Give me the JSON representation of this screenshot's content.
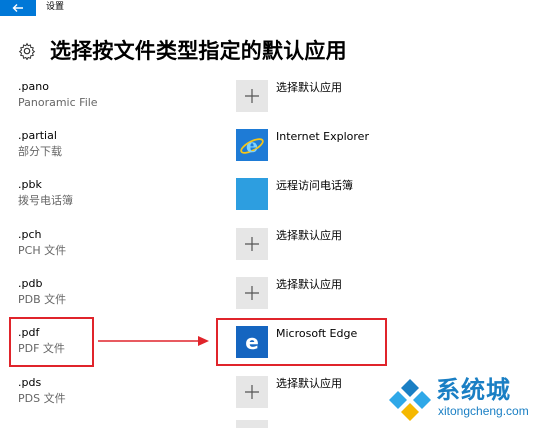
{
  "window": {
    "title": "设置"
  },
  "header": {
    "title": "选择按文件类型指定的默认应用"
  },
  "rows": [
    {
      "ext": ".pano",
      "desc": "Panoramic File",
      "app": "选择默认应用",
      "icon": "plus-icon"
    },
    {
      "ext": ".partial",
      "desc": "部分下载",
      "app": "Internet Explorer",
      "icon": "internet-explorer-icon"
    },
    {
      "ext": ".pbk",
      "desc": "拨号电话簿",
      "app": "远程访问电话簿",
      "icon": "blank-app-icon"
    },
    {
      "ext": ".pch",
      "desc": "PCH 文件",
      "app": "选择默认应用",
      "icon": "plus-icon"
    },
    {
      "ext": ".pdb",
      "desc": "PDB 文件",
      "app": "选择默认应用",
      "icon": "plus-icon"
    },
    {
      "ext": ".pdf",
      "desc": "PDF 文件",
      "app": "Microsoft Edge",
      "icon": "microsoft-edge-icon"
    },
    {
      "ext": ".pds",
      "desc": "PDS 文件",
      "app": "选择默认应用",
      "icon": "plus-icon"
    }
  ],
  "watermark": {
    "brand": "系统城",
    "url": "xitongcheng.com"
  },
  "colors": {
    "accent": "#0078d7",
    "annotation": "#e0242b",
    "tile_gray": "#e6e6e6",
    "edge_blue": "#1565c0",
    "watermark": "#1a7fc4"
  }
}
